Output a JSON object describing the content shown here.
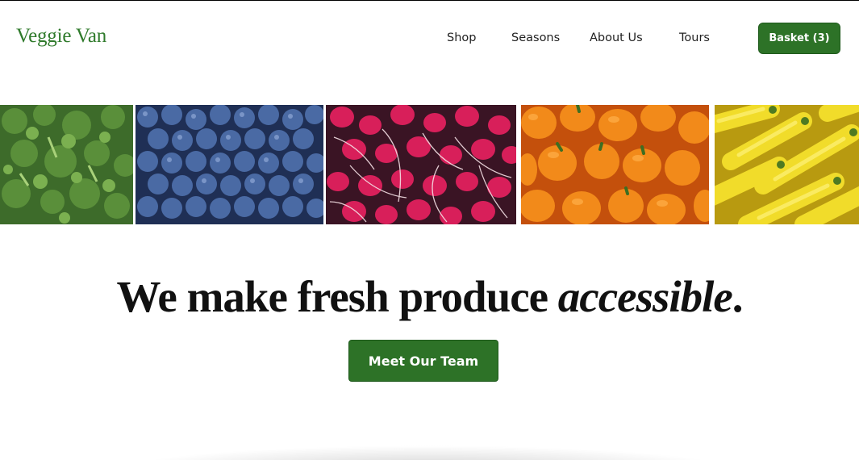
{
  "header": {
    "logo": "Veggie Van",
    "nav": {
      "shop": "Shop",
      "seasons": "Seasons",
      "about": "About Us",
      "tours": "Tours"
    },
    "basket_label": "Basket (3)"
  },
  "gallery": {
    "tiles": [
      "broccoli",
      "blueberries",
      "radishes",
      "bell-peppers",
      "yellow-squash"
    ]
  },
  "hero": {
    "headline_main": "We make fresh produce ",
    "headline_emphasis": "accessible",
    "headline_end": ".",
    "cta_label": "Meet Our Team"
  },
  "colors": {
    "brand_green": "#2d7227",
    "logo_green": "#2f7a2b"
  }
}
